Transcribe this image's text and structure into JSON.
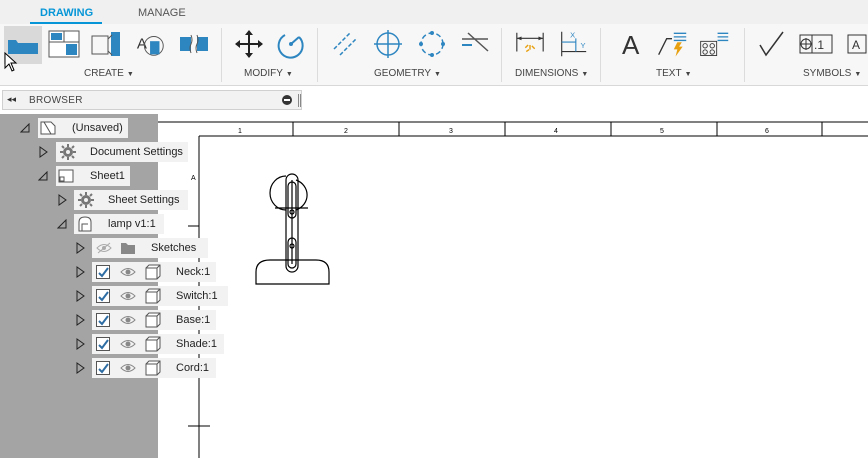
{
  "tabs": [
    {
      "label": "DRAWING",
      "active": true
    },
    {
      "label": "MANAGE",
      "active": false
    }
  ],
  "toolbar": {
    "groups": [
      {
        "label": "CREATE",
        "icons": [
          "base-view-icon",
          "projected-view-icon",
          "section-view-icon",
          "detail-view-icon",
          "break-view-icon"
        ]
      },
      {
        "label": "MODIFY",
        "icons": [
          "move-icon",
          "rotate-icon"
        ]
      },
      {
        "label": "GEOMETRY",
        "icons": [
          "centerline-icon",
          "center-mark-icon",
          "center-mark-pattern-icon",
          "edge-extension-icon"
        ]
      },
      {
        "label": "DIMENSIONS",
        "icons": [
          "dimension-icon",
          "ordinate-dimension-icon"
        ]
      },
      {
        "label": "TEXT",
        "icons": [
          "text-icon",
          "leader-icon",
          "balloon-icon"
        ]
      },
      {
        "label": "SYMBOLS",
        "icons": [
          "surface-texture-icon",
          "feature-control-frame-icon",
          "datum-identifier-icon"
        ]
      }
    ],
    "glyphs": {
      "text": "A",
      "fcf": ".1",
      "datum": "A",
      "x": "X",
      "y": "Y"
    }
  },
  "browser": {
    "title": "BROWSER",
    "tree": {
      "root": "(Unsaved)",
      "document_settings": "Document Settings",
      "sheet": "Sheet1",
      "sheet_settings": "Sheet Settings",
      "view": "lamp v1:1",
      "sketches": "Sketches",
      "bodies": [
        "Neck:1",
        "Switch:1",
        "Base:1",
        "Shade:1",
        "Cord:1"
      ]
    }
  },
  "ruler": {
    "numbers": [
      "1",
      "2",
      "3",
      "4",
      "5",
      "6"
    ],
    "row_letter": "A"
  },
  "colors": {
    "accent": "#0696d7",
    "panel_gray": "#a4a4a4",
    "toolbar_bg": "#f7f7f7"
  }
}
